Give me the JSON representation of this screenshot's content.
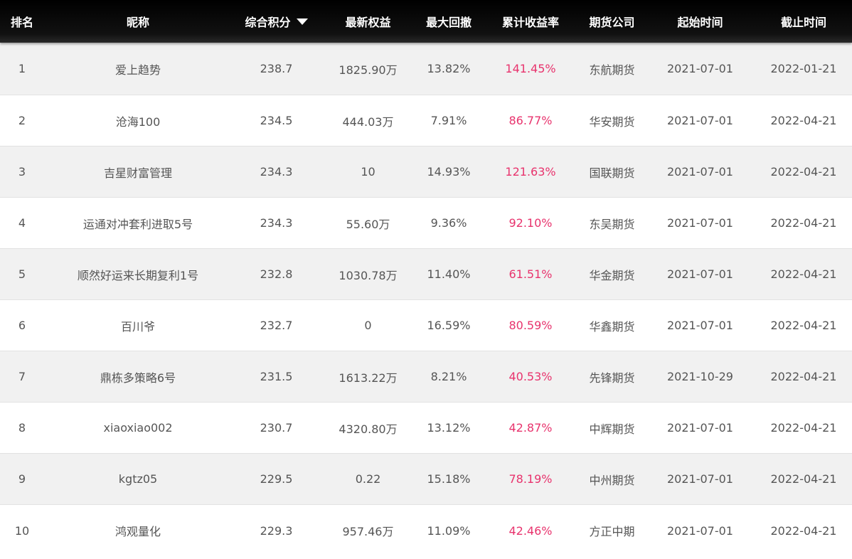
{
  "header": {
    "rank": "排名",
    "name": "昵称",
    "score": "综合积分",
    "equity": "最新权益",
    "max_drawdown": "最大回撤",
    "cumulative_return": "累计收益率",
    "company": "期货公司",
    "start_date": "起始时间",
    "end_date": "截止时间",
    "sort_icon": "caret-down-icon"
  },
  "colors": {
    "return_text": "#e8336d",
    "header_bg": "#000000",
    "row_alt_bg": "#f1f1f1"
  },
  "rows": [
    {
      "rank": "1",
      "name": "爱上趋势",
      "score": "238.7",
      "equity": "1825.90万",
      "max_drawdown": "13.82%",
      "cumulative_return": "141.45%",
      "company": "东航期货",
      "start_date": "2021-07-01",
      "end_date": "2022-01-21"
    },
    {
      "rank": "2",
      "name": "沧海100",
      "score": "234.5",
      "equity": "444.03万",
      "max_drawdown": "7.91%",
      "cumulative_return": "86.77%",
      "company": "华安期货",
      "start_date": "2021-07-01",
      "end_date": "2022-04-21"
    },
    {
      "rank": "3",
      "name": "吉星财富管理",
      "score": "234.3",
      "equity": "10",
      "max_drawdown": "14.93%",
      "cumulative_return": "121.63%",
      "company": "国联期货",
      "start_date": "2021-07-01",
      "end_date": "2022-04-21"
    },
    {
      "rank": "4",
      "name": "运通对冲套利进取5号",
      "score": "234.3",
      "equity": "55.60万",
      "max_drawdown": "9.36%",
      "cumulative_return": "92.10%",
      "company": "东吴期货",
      "start_date": "2021-07-01",
      "end_date": "2022-04-21"
    },
    {
      "rank": "5",
      "name": "顺然好运来长期复利1号",
      "score": "232.8",
      "equity": "1030.78万",
      "max_drawdown": "11.40%",
      "cumulative_return": "61.51%",
      "company": "华金期货",
      "start_date": "2021-07-01",
      "end_date": "2022-04-21"
    },
    {
      "rank": "6",
      "name": "百川爷",
      "score": "232.7",
      "equity": "0",
      "max_drawdown": "16.59%",
      "cumulative_return": "80.59%",
      "company": "华鑫期货",
      "start_date": "2021-07-01",
      "end_date": "2022-04-21"
    },
    {
      "rank": "7",
      "name": "鼎栋多策略6号",
      "score": "231.5",
      "equity": "1613.22万",
      "max_drawdown": "8.21%",
      "cumulative_return": "40.53%",
      "company": "先锋期货",
      "start_date": "2021-10-29",
      "end_date": "2022-04-21"
    },
    {
      "rank": "8",
      "name": "xiaoxiao002",
      "score": "230.7",
      "equity": "4320.80万",
      "max_drawdown": "13.12%",
      "cumulative_return": "42.87%",
      "company": "中辉期货",
      "start_date": "2021-07-01",
      "end_date": "2022-04-21"
    },
    {
      "rank": "9",
      "name": "kgtz05",
      "score": "229.5",
      "equity": "0.22",
      "max_drawdown": "15.18%",
      "cumulative_return": "78.19%",
      "company": "中州期货",
      "start_date": "2021-07-01",
      "end_date": "2022-04-21"
    },
    {
      "rank": "10",
      "name": "鸿观量化",
      "score": "229.3",
      "equity": "957.46万",
      "max_drawdown": "11.09%",
      "cumulative_return": "42.46%",
      "company": "方正中期",
      "start_date": "2021-07-01",
      "end_date": "2022-04-21"
    }
  ]
}
